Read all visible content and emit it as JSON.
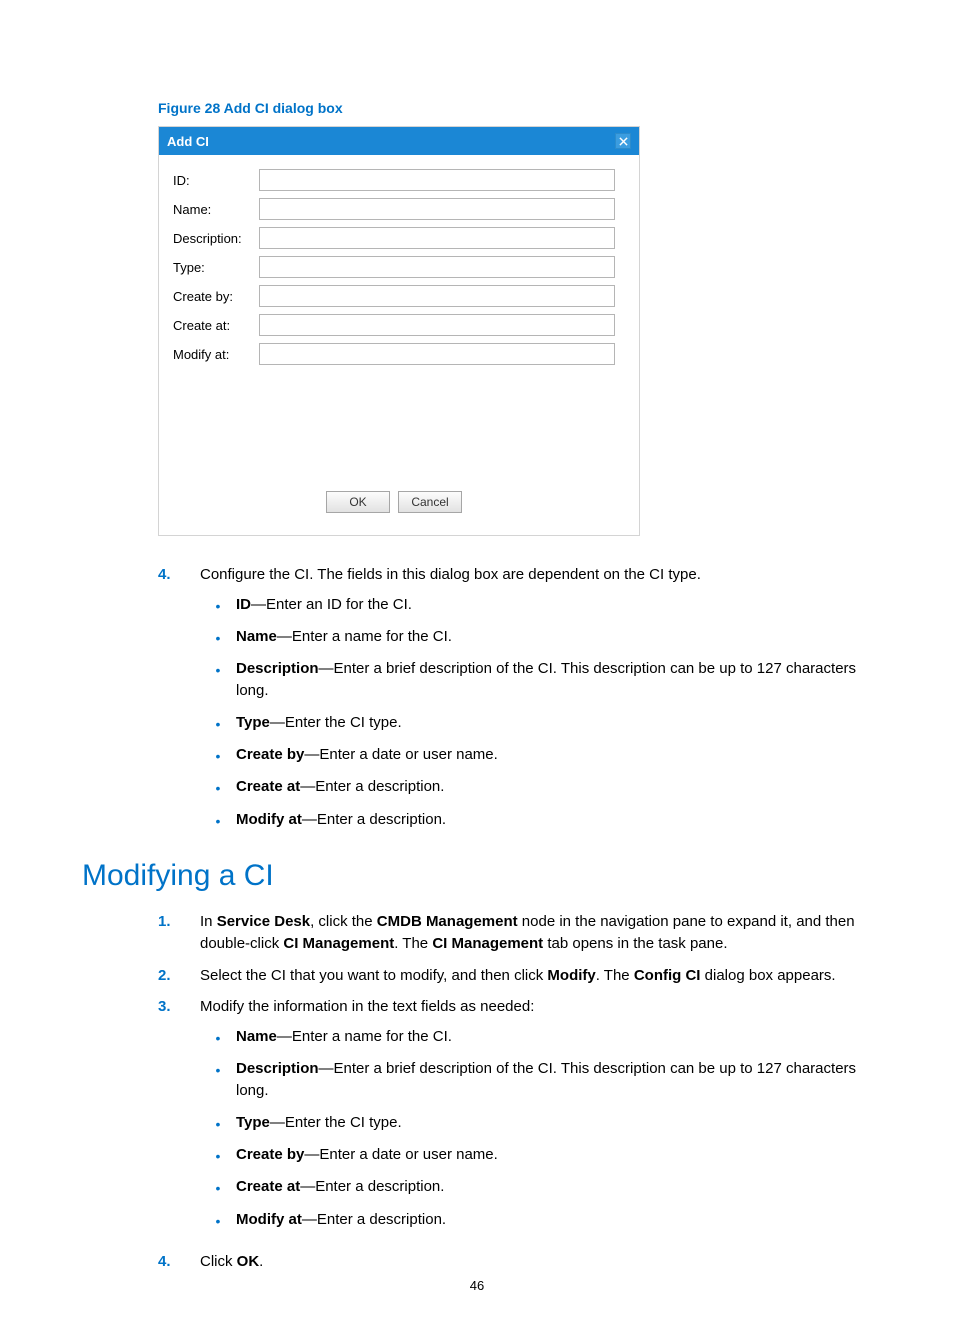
{
  "figure_caption": "Figure 28 Add CI dialog box",
  "dialog": {
    "title": "Add CI",
    "fields": {
      "id": "ID:",
      "name": "Name:",
      "description": "Description:",
      "type": "Type:",
      "create_by": "Create by:",
      "create_at": "Create at:",
      "modify_at": "Modify at:"
    },
    "ok": "OK",
    "cancel": "Cancel"
  },
  "step4_num": "4.",
  "step4_text": "Configure the CI. The fields in this dialog box are dependent on the CI type.",
  "bullets1": {
    "id_b": "ID",
    "id_t": "—Enter an ID for the CI.",
    "name_b": "Name",
    "name_t": "—Enter a name for the CI.",
    "desc_b": "Description",
    "desc_t": "—Enter a brief description of the CI. This description can be up to 127 characters long.",
    "type_b": "Type",
    "type_t": "—Enter the CI type.",
    "cby_b": "Create by",
    "cby_t": "—Enter a date or user name.",
    "cat_b": "Create at",
    "cat_t": "—Enter a description.",
    "mat_b": "Modify at",
    "mat_t": "—Enter a description."
  },
  "h1": "Modifying a CI",
  "steps2": {
    "n1": "1.",
    "t1a": "In ",
    "t1b": "Service Desk",
    "t1c": ", click the ",
    "t1d": "CMDB Management",
    "t1e": " node in the navigation pane to expand it, and then double-click ",
    "t1f": "CI Management",
    "t1g": ". The ",
    "t1h": "CI Management",
    "t1i": " tab opens in the task pane.",
    "n2": "2.",
    "t2a": "Select the CI that you want to modify, and then click ",
    "t2b": "Modify",
    "t2c": ". The ",
    "t2d": "Config CI",
    "t2e": " dialog box appears.",
    "n3": "3.",
    "t3": "Modify the information in the text fields as needed:",
    "n4": "4.",
    "t4a": "Click ",
    "t4b": "OK",
    "t4c": "."
  },
  "bullets2": {
    "name_b": "Name",
    "name_t": "—Enter a name for the CI.",
    "desc_b": "Description",
    "desc_t": "—Enter a brief description of the CI. This description can be up to 127 characters long.",
    "type_b": "Type",
    "type_t": "—Enter the CI type.",
    "cby_b": "Create by",
    "cby_t": "—Enter a date or user name.",
    "cat_b": "Create at",
    "cat_t": "—Enter a description.",
    "mat_b": "Modify at",
    "mat_t": "—Enter a description."
  },
  "page_number": "46"
}
